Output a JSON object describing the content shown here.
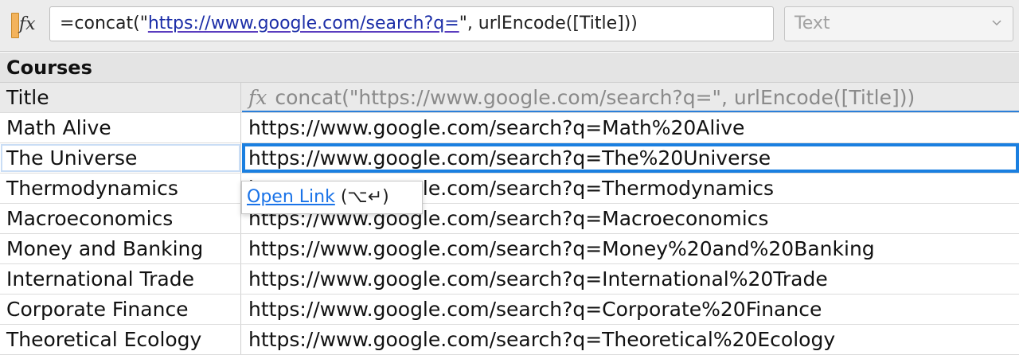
{
  "toolbar": {
    "formula_prefix": "=concat(\"",
    "formula_url": "https://www.google.com/search?q=",
    "formula_suffix": "\", urlEncode([Title]))",
    "column_type": "Text"
  },
  "table": {
    "section_title": "Courses",
    "column_a_header": "Title",
    "column_b_header": "concat(\"https://www.google.com/search?q=\", urlEncode([Title]))",
    "rows": [
      {
        "title": "Math Alive",
        "url": "https://www.google.com/search?q=Math%20Alive"
      },
      {
        "title": "The Universe",
        "url": "https://www.google.com/search?q=The%20Universe"
      },
      {
        "title": "Thermodynamics",
        "url": "https://www.google.com/search?q=Thermodynamics"
      },
      {
        "title": "Macroeconomics",
        "url": "https://www.google.com/search?q=Macroeconomics"
      },
      {
        "title": "Money and Banking",
        "url": "https://www.google.com/search?q=Money%20and%20Banking"
      },
      {
        "title": "International Trade",
        "url": "https://www.google.com/search?q=International%20Trade"
      },
      {
        "title": "Corporate Finance",
        "url": "https://www.google.com/search?q=Corporate%20Finance"
      },
      {
        "title": "Theoretical Ecology",
        "url": "https://www.google.com/search?q=Theoretical%20Ecology"
      }
    ]
  },
  "popup": {
    "link_label": "Open Link",
    "shortcut": "(⌥↵)"
  },
  "colors": {
    "selection": "#1a7fe0",
    "link": "#1a73e8"
  }
}
